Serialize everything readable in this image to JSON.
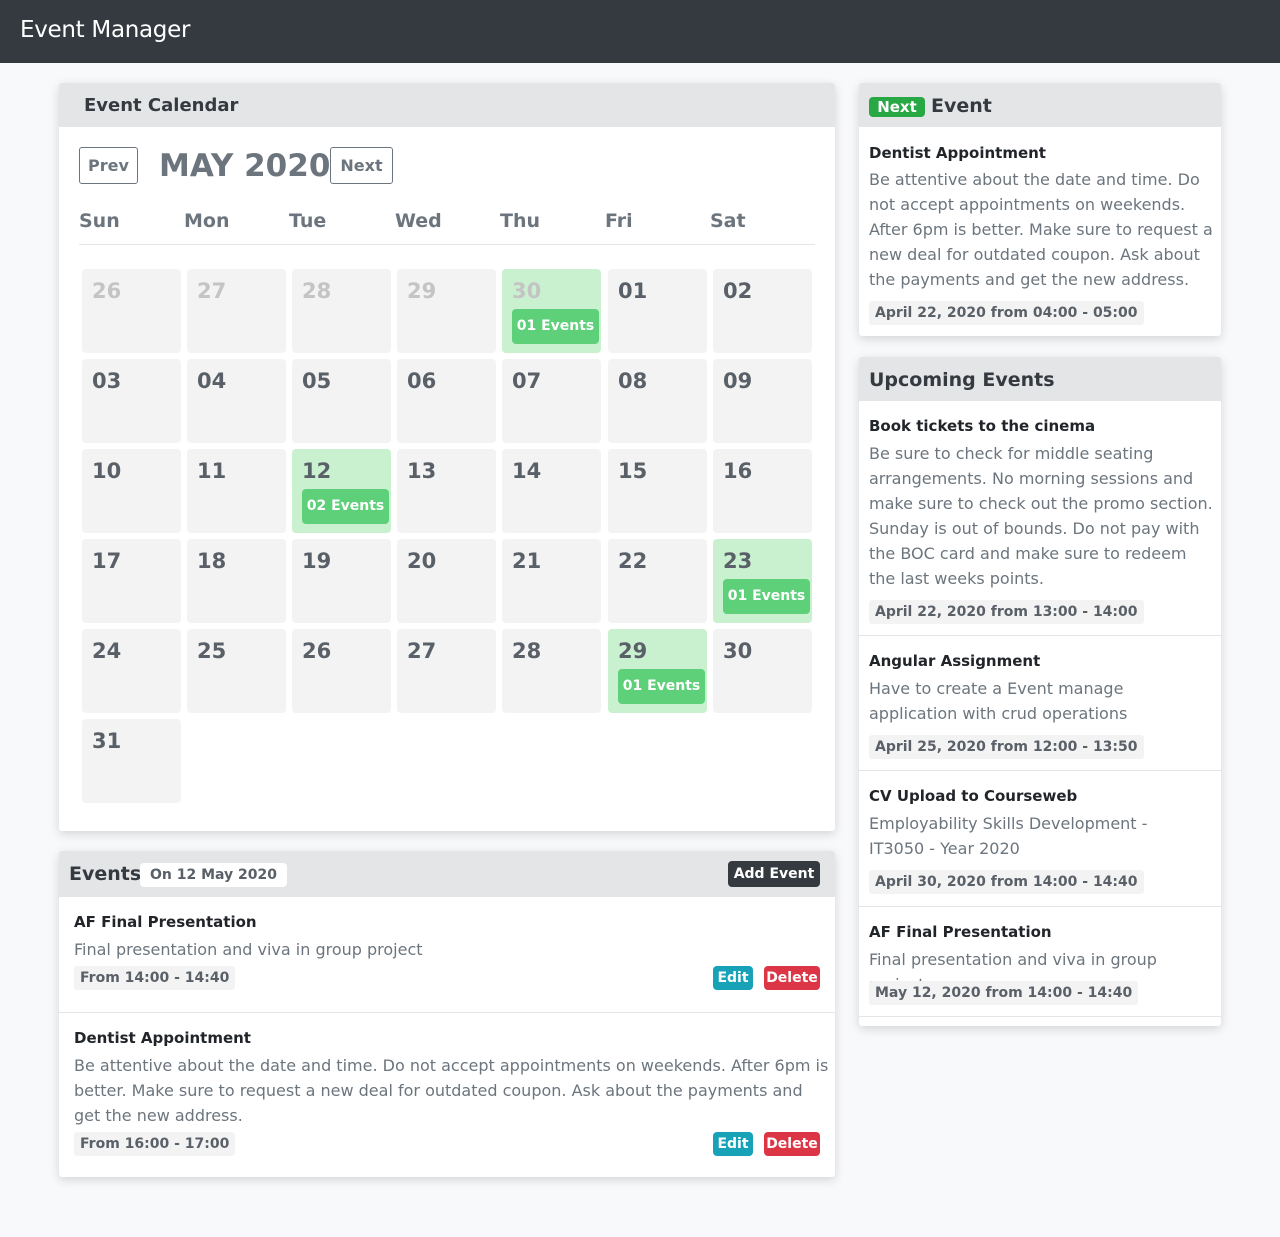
{
  "app": {
    "title": "Event Manager"
  },
  "calendar": {
    "header": "Event Calendar",
    "prev_label": "Prev",
    "next_label": "Next",
    "month_label": "MAY 2020",
    "weekdays": [
      "Sun",
      "Mon",
      "Tue",
      "Wed",
      "Thu",
      "Fri",
      "Sat"
    ],
    "weeks": [
      [
        {
          "day": "26",
          "muted": true
        },
        {
          "day": "27",
          "muted": true
        },
        {
          "day": "28",
          "muted": true
        },
        {
          "day": "29",
          "muted": true
        },
        {
          "day": "30",
          "muted": true,
          "events": "01 Events"
        },
        {
          "day": "01"
        },
        {
          "day": "02"
        }
      ],
      [
        {
          "day": "03"
        },
        {
          "day": "04"
        },
        {
          "day": "05"
        },
        {
          "day": "06"
        },
        {
          "day": "07"
        },
        {
          "day": "08"
        },
        {
          "day": "09"
        }
      ],
      [
        {
          "day": "10"
        },
        {
          "day": "11"
        },
        {
          "day": "12",
          "events": "02 Events"
        },
        {
          "day": "13"
        },
        {
          "day": "14"
        },
        {
          "day": "15"
        },
        {
          "day": "16"
        }
      ],
      [
        {
          "day": "17"
        },
        {
          "day": "18"
        },
        {
          "day": "19"
        },
        {
          "day": "20"
        },
        {
          "day": "21"
        },
        {
          "day": "22"
        },
        {
          "day": "23",
          "events": "01 Events"
        }
      ],
      [
        {
          "day": "24"
        },
        {
          "day": "25"
        },
        {
          "day": "26"
        },
        {
          "day": "27"
        },
        {
          "day": "28"
        },
        {
          "day": "29",
          "events": "01 Events"
        },
        {
          "day": "30"
        }
      ],
      [
        {
          "day": "31"
        }
      ]
    ]
  },
  "events_panel": {
    "title": "Events",
    "date_label": "On 12 May 2020",
    "add_label": "Add Event",
    "items": [
      {
        "title": "AF Final Presentation",
        "description": "Final presentation and viva in group project",
        "time": "From 14:00 - 14:40",
        "edit_label": "Edit",
        "delete_label": "Delete"
      },
      {
        "title": "Dentist Appointment",
        "description": "Be attentive about the date and time. Do not accept appointments on weekends. After 6pm is better. Make sure to request a new deal for outdated coupon. Ask about the payments and get the new address.",
        "time": "From 16:00 - 17:00",
        "edit_label": "Edit",
        "delete_label": "Delete"
      }
    ]
  },
  "next_event": {
    "badge": "Next",
    "header": "Event",
    "title": "Dentist Appointment",
    "description": "Be attentive about the date and time. Do not accept appointments on weekends. After 6pm is better. Make sure to request a new deal for outdated coupon. Ask about the payments and get the new address.",
    "time": "April 22, 2020 from 04:00 - 05:00"
  },
  "upcoming": {
    "header": "Upcoming Events",
    "items": [
      {
        "title": "Book tickets to the cinema",
        "description": "Be sure to check for middle seating arrangements. No morning sessions and make sure to check out the promo section. Sunday is out of bounds. Do not pay with the BOC card and make sure to redeem the last weeks points.",
        "time": "April 22, 2020 from 13:00 - 14:00"
      },
      {
        "title": "Angular Assignment",
        "description": "Have to create a Event manage application with crud operations",
        "time": "April 25, 2020 from 12:00 - 13:50"
      },
      {
        "title": "CV Upload to Courseweb",
        "description": "Employability Skills Development - IT3050 - Year 2020",
        "time": "April 30, 2020 from 14:00 - 14:40"
      },
      {
        "title": "AF Final Presentation",
        "description": "Final presentation and viva in group project",
        "time": "May 12, 2020 from 14:00 - 14:40"
      }
    ]
  },
  "colors": {
    "navbar": "#343a40",
    "event_day": "#c9f1d0",
    "event_badge": "#5ed07a",
    "next_badge": "#28a745",
    "edit": "#17a2b8",
    "delete": "#dc3545"
  }
}
